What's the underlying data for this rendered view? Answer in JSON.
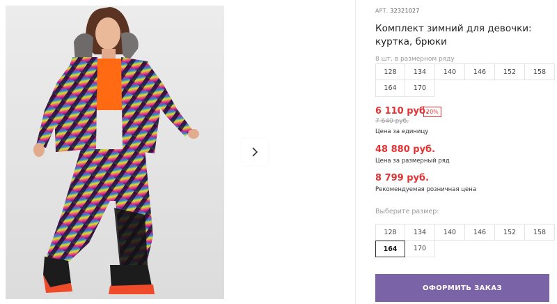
{
  "product": {
    "sku_label": "АРТ.",
    "sku": "32321027",
    "title": "Комплект зимний для девочки: куртка, брюки"
  },
  "set_info": {
    "hint": "8 шт. в размерном ряду",
    "sizes": [
      "128",
      "134",
      "140",
      "146",
      "152",
      "158",
      "164",
      "170"
    ]
  },
  "pricing": {
    "unit_price": "6 110 руб.",
    "discount": "20%",
    "old_price": "7 640 руб.",
    "unit_caption": "Цена за единицу",
    "set_price": "48 880 руб.",
    "set_caption": "Цена за размерный ряд",
    "retail_price": "8 799 руб.",
    "retail_caption": "Рекомендуемая розничная цена"
  },
  "size_picker": {
    "hint": "Выберите размер:",
    "sizes": [
      "128",
      "134",
      "140",
      "146",
      "152",
      "158",
      "164",
      "170"
    ],
    "selected": "164"
  },
  "actions": {
    "order_label": "ОФОРМИТЬ ЗАКАЗ"
  },
  "colors": {
    "accent": "#e53335",
    "button": "#7b63a8"
  },
  "icons": {
    "next": "chevron-right-icon"
  }
}
